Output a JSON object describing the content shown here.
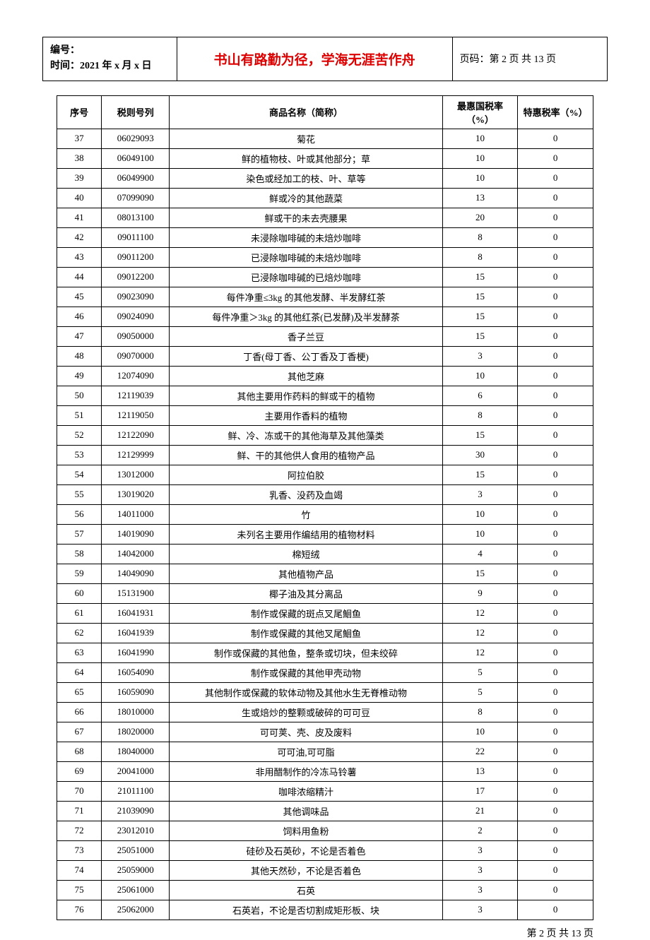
{
  "header": {
    "id_label": "编号：",
    "time_label": "时间：2021 年 x 月 x 日",
    "motto": "书山有路勤为径，学海无涯苦作舟",
    "page_label": "页码：第 2 页 共 13 页"
  },
  "table": {
    "headers": {
      "seq": "序号",
      "code": "税则号列",
      "name": "商品名称（简称）",
      "rate1": "最惠国税率（%）",
      "rate2": "特惠税率（%）"
    },
    "rows": [
      {
        "seq": "37",
        "code": "06029093",
        "name": "菊花",
        "rate1": "10",
        "rate2": "0"
      },
      {
        "seq": "38",
        "code": "06049100",
        "name": "鲜的植物枝、叶或其他部分；草",
        "rate1": "10",
        "rate2": "0"
      },
      {
        "seq": "39",
        "code": "06049900",
        "name": "染色或经加工的枝、叶、草等",
        "rate1": "10",
        "rate2": "0"
      },
      {
        "seq": "40",
        "code": "07099090",
        "name": "鲜或冷的其他蔬菜",
        "rate1": "13",
        "rate2": "0"
      },
      {
        "seq": "41",
        "code": "08013100",
        "name": "鲜或干的未去壳腰果",
        "rate1": "20",
        "rate2": "0"
      },
      {
        "seq": "42",
        "code": "09011100",
        "name": "未浸除咖啡碱的未焙炒咖啡",
        "rate1": "8",
        "rate2": "0"
      },
      {
        "seq": "43",
        "code": "09011200",
        "name": "已浸除咖啡碱的未焙炒咖啡",
        "rate1": "8",
        "rate2": "0"
      },
      {
        "seq": "44",
        "code": "09012200",
        "name": "已浸除咖啡碱的已焙炒咖啡",
        "rate1": "15",
        "rate2": "0"
      },
      {
        "seq": "45",
        "code": "09023090",
        "name": "每件净重≤3kg 的其他发酵、半发酵红茶",
        "rate1": "15",
        "rate2": "0"
      },
      {
        "seq": "46",
        "code": "09024090",
        "name": "每件净重＞3kg 的其他红茶(已发酵)及半发酵茶",
        "rate1": "15",
        "rate2": "0"
      },
      {
        "seq": "47",
        "code": "09050000",
        "name": "香子兰豆",
        "rate1": "15",
        "rate2": "0"
      },
      {
        "seq": "48",
        "code": "09070000",
        "name": "丁香(母丁香、公丁香及丁香梗)",
        "rate1": "3",
        "rate2": "0"
      },
      {
        "seq": "49",
        "code": "12074090",
        "name": "其他芝麻",
        "rate1": "10",
        "rate2": "0"
      },
      {
        "seq": "50",
        "code": "12119039",
        "name": "其他主要用作药料的鲜或干的植物",
        "rate1": "6",
        "rate2": "0"
      },
      {
        "seq": "51",
        "code": "12119050",
        "name": "主要用作香料的植物",
        "rate1": "8",
        "rate2": "0"
      },
      {
        "seq": "52",
        "code": "12122090",
        "name": "鲜、冷、冻或干的其他海草及其他藻类",
        "rate1": "15",
        "rate2": "0"
      },
      {
        "seq": "53",
        "code": "12129999",
        "name": "鲜、干的其他供人食用的植物产品",
        "rate1": "30",
        "rate2": "0"
      },
      {
        "seq": "54",
        "code": "13012000",
        "name": "阿拉伯胶",
        "rate1": "15",
        "rate2": "0"
      },
      {
        "seq": "55",
        "code": "13019020",
        "name": "乳香、没药及血竭",
        "rate1": "3",
        "rate2": "0"
      },
      {
        "seq": "56",
        "code": "14011000",
        "name": "竹",
        "rate1": "10",
        "rate2": "0"
      },
      {
        "seq": "57",
        "code": "14019090",
        "name": "未列名主要用作编结用的植物材料",
        "rate1": "10",
        "rate2": "0"
      },
      {
        "seq": "58",
        "code": "14042000",
        "name": "棉短绒",
        "rate1": "4",
        "rate2": "0"
      },
      {
        "seq": "59",
        "code": "14049090",
        "name": "其他植物产品",
        "rate1": "15",
        "rate2": "0"
      },
      {
        "seq": "60",
        "code": "15131900",
        "name": "椰子油及其分离品",
        "rate1": "9",
        "rate2": "0"
      },
      {
        "seq": "61",
        "code": "16041931",
        "name": "制作或保藏的斑点叉尾鮰鱼",
        "rate1": "12",
        "rate2": "0"
      },
      {
        "seq": "62",
        "code": "16041939",
        "name": "制作或保藏的其他叉尾鮰鱼",
        "rate1": "12",
        "rate2": "0"
      },
      {
        "seq": "63",
        "code": "16041990",
        "name": "制作或保藏的其他鱼，整条或切块，但未绞碎",
        "rate1": "12",
        "rate2": "0"
      },
      {
        "seq": "64",
        "code": "16054090",
        "name": "制作或保藏的其他甲壳动物",
        "rate1": "5",
        "rate2": "0"
      },
      {
        "seq": "65",
        "code": "16059090",
        "name": "其他制作或保藏的软体动物及其他水生无脊椎动物",
        "rate1": "5",
        "rate2": "0"
      },
      {
        "seq": "66",
        "code": "18010000",
        "name": "生或焙炒的整颗或破碎的可可豆",
        "rate1": "8",
        "rate2": "0"
      },
      {
        "seq": "67",
        "code": "18020000",
        "name": "可可荚、壳、皮及废料",
        "rate1": "10",
        "rate2": "0"
      },
      {
        "seq": "68",
        "code": "18040000",
        "name": "可可油,可可脂",
        "rate1": "22",
        "rate2": "0"
      },
      {
        "seq": "69",
        "code": "20041000",
        "name": "非用醋制作的冷冻马铃薯",
        "rate1": "13",
        "rate2": "0"
      },
      {
        "seq": "70",
        "code": "21011100",
        "name": "咖啡浓缩精汁",
        "rate1": "17",
        "rate2": "0"
      },
      {
        "seq": "71",
        "code": "21039090",
        "name": "其他调味品",
        "rate1": "21",
        "rate2": "0"
      },
      {
        "seq": "72",
        "code": "23012010",
        "name": "饲料用鱼粉",
        "rate1": "2",
        "rate2": "0"
      },
      {
        "seq": "73",
        "code": "25051000",
        "name": "硅砂及石英砂，不论是否着色",
        "rate1": "3",
        "rate2": "0"
      },
      {
        "seq": "74",
        "code": "25059000",
        "name": "其他天然砂，不论是否着色",
        "rate1": "3",
        "rate2": "0"
      },
      {
        "seq": "75",
        "code": "25061000",
        "name": "石英",
        "rate1": "3",
        "rate2": "0"
      },
      {
        "seq": "76",
        "code": "25062000",
        "name": "石英岩，不论是否切割成矩形板、块",
        "rate1": "3",
        "rate2": "0"
      }
    ]
  },
  "footer": {
    "text": "第 2 页 共 13 页"
  }
}
